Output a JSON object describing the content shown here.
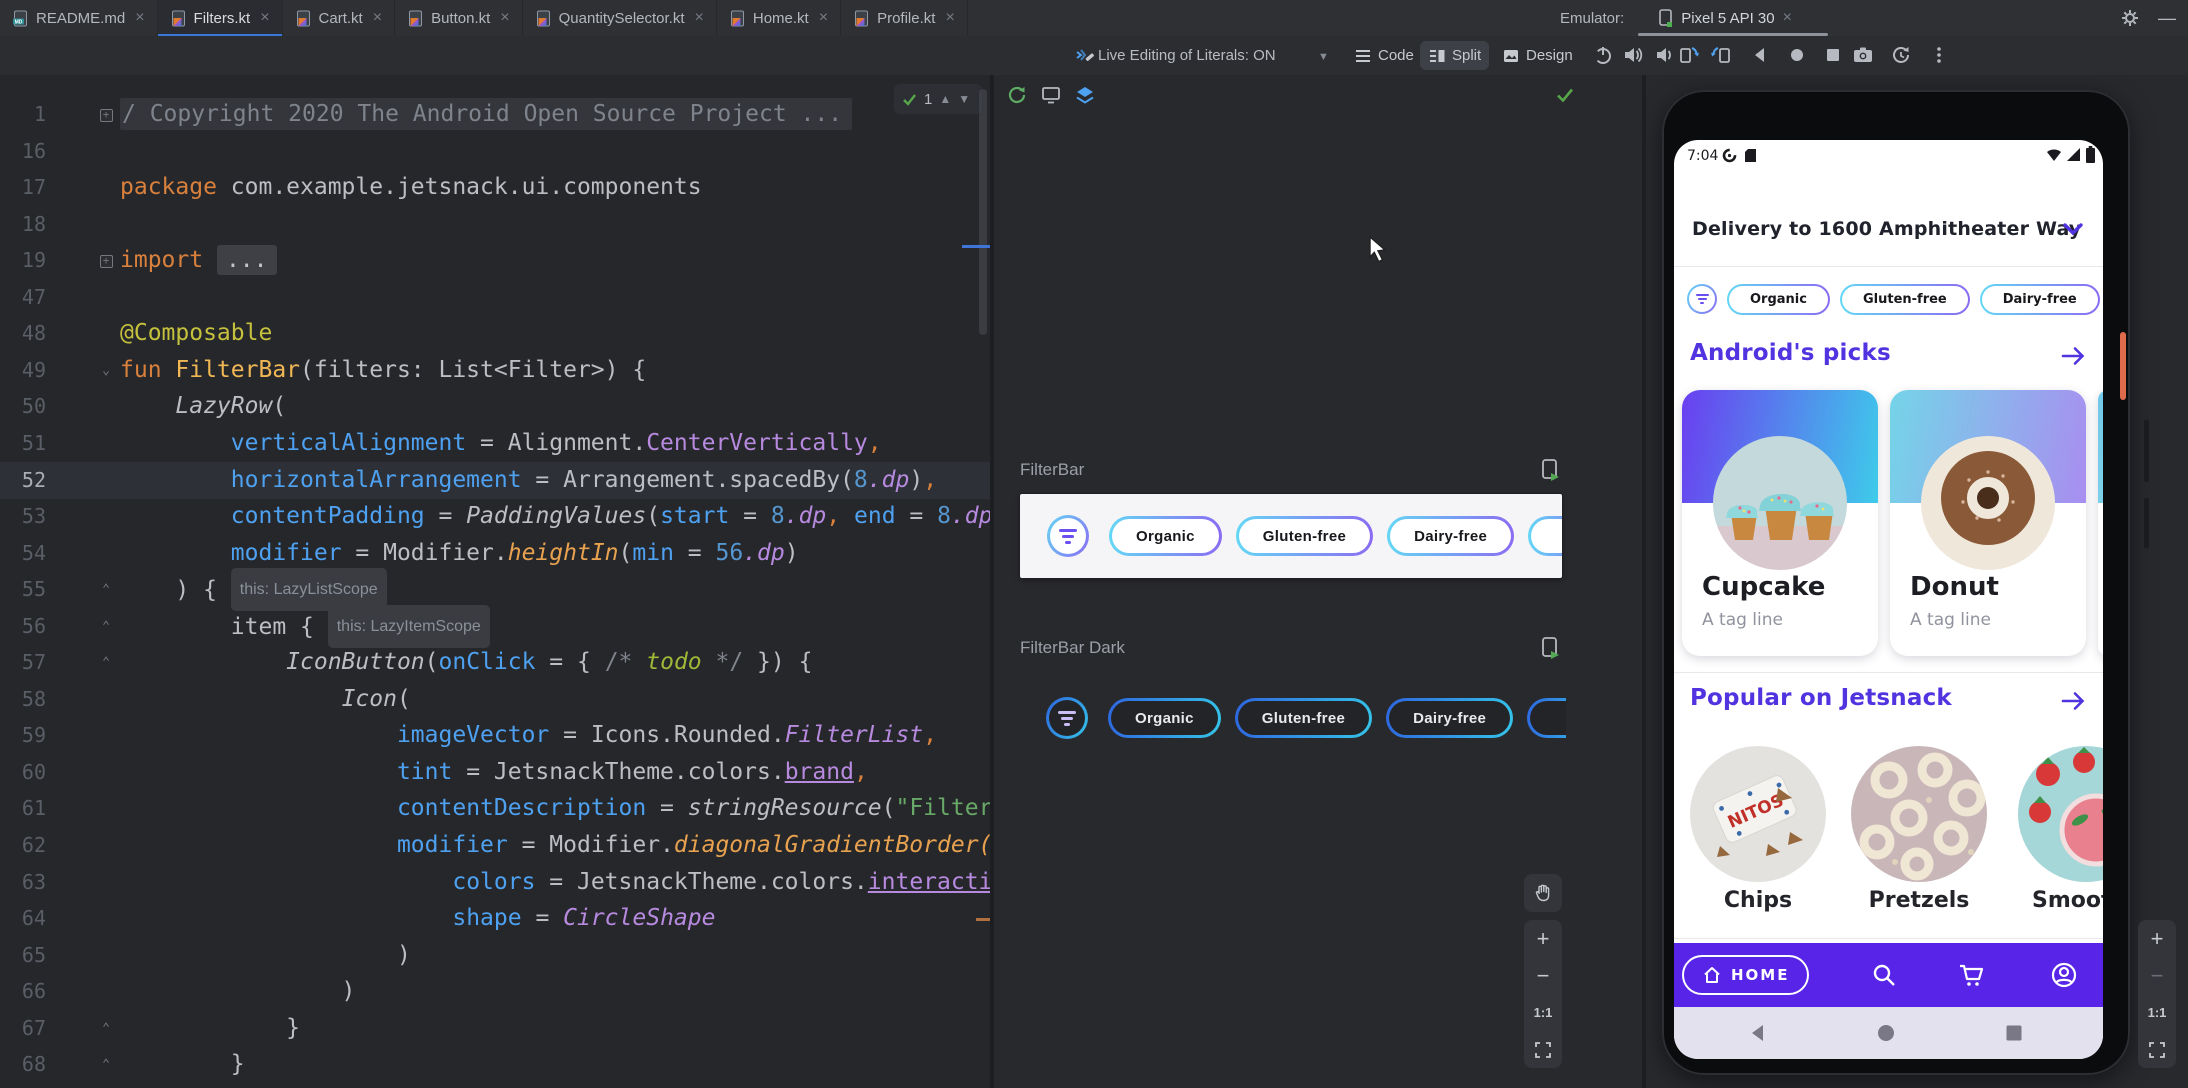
{
  "tabs": [
    {
      "label": "README.md",
      "icon": "markdown",
      "active": false
    },
    {
      "label": "Filters.kt",
      "icon": "kotlin",
      "active": true
    },
    {
      "label": "Cart.kt",
      "icon": "kotlin",
      "active": false
    },
    {
      "label": "Button.kt",
      "icon": "kotlin",
      "active": false
    },
    {
      "label": "QuantitySelector.kt",
      "icon": "kotlin",
      "active": false
    },
    {
      "label": "Home.kt",
      "icon": "kotlin",
      "active": false
    },
    {
      "label": "Profile.kt",
      "icon": "kotlin",
      "active": false
    }
  ],
  "emulator_header": {
    "label": "Emulator:",
    "device": "Pixel 5 API 30"
  },
  "toolbar": {
    "live_edit": "Live Editing of Literals: ON",
    "modes": [
      {
        "label": "Code"
      },
      {
        "label": "Split"
      },
      {
        "label": "Design"
      }
    ]
  },
  "editor": {
    "inspection_count": "1",
    "lines": [
      {
        "n": "1",
        "fold": "plus",
        "tokens": [
          [
            "comfold",
            "/ Copyright 2020 The Android Open Source Project ..."
          ]
        ]
      },
      {
        "n": "16",
        "tokens": []
      },
      {
        "n": "17",
        "tokens": [
          [
            "kw",
            "package"
          ],
          [
            "pl",
            " com.example.jetsnack.ui.components"
          ]
        ]
      },
      {
        "n": "18",
        "tokens": []
      },
      {
        "n": "19",
        "fold": "plus",
        "tokens": [
          [
            "kw",
            "import"
          ],
          [
            "pl",
            " "
          ],
          [
            "fold",
            "..."
          ]
        ]
      },
      {
        "n": "47",
        "tokens": []
      },
      {
        "n": "48",
        "tokens": [
          [
            "ann",
            "@Composable"
          ]
        ]
      },
      {
        "n": "49",
        "fold": "down",
        "tokens": [
          [
            "kw",
            "fun "
          ],
          [
            "fn",
            "FilterBar"
          ],
          [
            "pl",
            "(filters: List<Filter>) {"
          ]
        ]
      },
      {
        "n": "50",
        "tokens": [
          [
            "pl",
            "    "
          ],
          [
            "it",
            "LazyRow"
          ],
          [
            "pl",
            "("
          ]
        ]
      },
      {
        "n": "51",
        "tokens": [
          [
            "pl",
            "        "
          ],
          [
            "pa",
            "verticalAlignment"
          ],
          [
            "pl",
            " = Alignment."
          ],
          [
            "pr",
            "CenterVertically"
          ],
          [
            "kw",
            ","
          ]
        ]
      },
      {
        "n": "52",
        "cur": true,
        "tokens": [
          [
            "pl",
            "        "
          ],
          [
            "pa",
            "horizontalArrangement"
          ],
          [
            "pl",
            " = Arrangement.spacedBy("
          ],
          [
            "nu",
            "8"
          ],
          [
            "pri",
            ".dp"
          ],
          [
            "pl",
            ")"
          ],
          [
            "kw",
            ","
          ]
        ]
      },
      {
        "n": "53",
        "tokens": [
          [
            "pl",
            "        "
          ],
          [
            "pa",
            "contentPadding"
          ],
          [
            "pl",
            " = "
          ],
          [
            "it",
            "PaddingValues"
          ],
          [
            "pl",
            "("
          ],
          [
            "pa",
            "start"
          ],
          [
            "pl",
            " = "
          ],
          [
            "nu",
            "8"
          ],
          [
            "pri",
            ".dp"
          ],
          [
            "kw",
            ","
          ],
          [
            "pl",
            " "
          ],
          [
            "pa",
            "end"
          ],
          [
            "pl",
            " = "
          ],
          [
            "nu",
            "8"
          ],
          [
            "pri",
            ".dp"
          ],
          [
            "pl",
            ")"
          ],
          [
            "kw",
            ","
          ]
        ]
      },
      {
        "n": "54",
        "tokens": [
          [
            "pl",
            "        "
          ],
          [
            "pa",
            "modifier"
          ],
          [
            "pl",
            " = Modifier."
          ],
          [
            "ex",
            "heightIn"
          ],
          [
            "pl",
            "("
          ],
          [
            "pa",
            "min"
          ],
          [
            "pl",
            " = "
          ],
          [
            "nu",
            "56"
          ],
          [
            "pri",
            ".dp"
          ],
          [
            "pl",
            ")"
          ]
        ]
      },
      {
        "n": "55",
        "fold": "up",
        "tokens": [
          [
            "pl",
            "    ) { "
          ],
          [
            "hint",
            "this: LazyListScope"
          ]
        ]
      },
      {
        "n": "56",
        "fold": "up",
        "tokens": [
          [
            "pl",
            "        item { "
          ],
          [
            "hint",
            "this: LazyItemScope"
          ]
        ]
      },
      {
        "n": "57",
        "fold": "up",
        "tokens": [
          [
            "pl",
            "            "
          ],
          [
            "it",
            "IconButton"
          ],
          [
            "pl",
            "("
          ],
          [
            "pa",
            "onClick"
          ],
          [
            "pl",
            " = { "
          ],
          [
            "com",
            "/* "
          ],
          [
            "todo",
            "todo"
          ],
          [
            "com",
            " */"
          ],
          [
            "pl",
            " }) {"
          ]
        ]
      },
      {
        "n": "58",
        "tokens": [
          [
            "pl",
            "                "
          ],
          [
            "it",
            "Icon"
          ],
          [
            "pl",
            "("
          ]
        ]
      },
      {
        "n": "59",
        "tokens": [
          [
            "pl",
            "                    "
          ],
          [
            "pa",
            "imageVector"
          ],
          [
            "pl",
            " = Icons.Rounded."
          ],
          [
            "pri",
            "FilterList"
          ],
          [
            "kw",
            ","
          ]
        ]
      },
      {
        "n": "60",
        "tokens": [
          [
            "pl",
            "                    "
          ],
          [
            "pa",
            "tint"
          ],
          [
            "pl",
            " = JetsnackTheme.colors."
          ],
          [
            "pru",
            "brand"
          ],
          [
            "kw",
            ","
          ]
        ]
      },
      {
        "n": "61",
        "tokens": [
          [
            "pl",
            "                    "
          ],
          [
            "pa",
            "contentDescription"
          ],
          [
            "pl",
            " = "
          ],
          [
            "it",
            "stringResource"
          ],
          [
            "pl",
            "("
          ],
          [
            "str",
            "\"Filters\""
          ],
          [
            "pl",
            ")"
          ]
        ]
      },
      {
        "n": "62",
        "tokens": [
          [
            "pl",
            "                    "
          ],
          [
            "pa",
            "modifier"
          ],
          [
            "pl",
            " = Modifier."
          ],
          [
            "ex",
            "diagonalGradientBorder("
          ]
        ]
      },
      {
        "n": "63",
        "tokens": [
          [
            "pl",
            "                        "
          ],
          [
            "pa",
            "colors"
          ],
          [
            "pl",
            " = JetsnackTheme.colors."
          ],
          [
            "pru",
            "interactivePrimary"
          ],
          [
            "kw",
            ","
          ]
        ]
      },
      {
        "n": "64",
        "tokens": [
          [
            "pl",
            "                        "
          ],
          [
            "pa",
            "shape"
          ],
          [
            "pl",
            " = "
          ],
          [
            "pri",
            "CircleShape"
          ]
        ]
      },
      {
        "n": "65",
        "tokens": [
          [
            "pl",
            "                    )"
          ]
        ]
      },
      {
        "n": "66",
        "tokens": [
          [
            "pl",
            "                )"
          ]
        ]
      },
      {
        "n": "67",
        "fold": "up",
        "tokens": [
          [
            "pl",
            "            }"
          ]
        ]
      },
      {
        "n": "68",
        "fold": "up",
        "tokens": [
          [
            "pl",
            "        }"
          ]
        ]
      }
    ]
  },
  "preview": {
    "section_light": "FilterBar",
    "section_dark": "FilterBar Dark",
    "chips": [
      "Organic",
      "Gluten-free",
      "Dairy-free"
    ],
    "zoom_label": "1:1"
  },
  "phone": {
    "status_time": "7:04",
    "address": "Delivery to 1600 Amphitheater Way",
    "filter_chips": [
      "Organic",
      "Gluten-free",
      "Dairy-free"
    ],
    "sections": {
      "picks": "Android's picks",
      "popular": "Popular on Jetsnack"
    },
    "snacks": [
      {
        "name": "Cupcake",
        "tag": "A tag line"
      },
      {
        "name": "Donut",
        "tag": "A tag line"
      }
    ],
    "popular_items": [
      {
        "name": "Chips"
      },
      {
        "name": "Pretzels"
      },
      {
        "name": "Smoothi"
      }
    ],
    "nav": {
      "home": "HOME"
    }
  },
  "emulator_panel": {
    "zoom_label": "1:1"
  },
  "colors": {
    "tab_underline": "#3677d8",
    "brand_purple": "#5724e8",
    "header_purple": "#5133e0",
    "chip_gradient_light": [
      "#63d7f5",
      "#8a6bf3"
    ],
    "chip_gradient_dark": [
      "#2e66e0",
      "#35c4e8"
    ],
    "card_gradient_cupcake": [
      "#6a3ff0",
      "#3ecbea"
    ],
    "card_gradient_donut": [
      "#74d4e8",
      "#a88ef0"
    ]
  }
}
